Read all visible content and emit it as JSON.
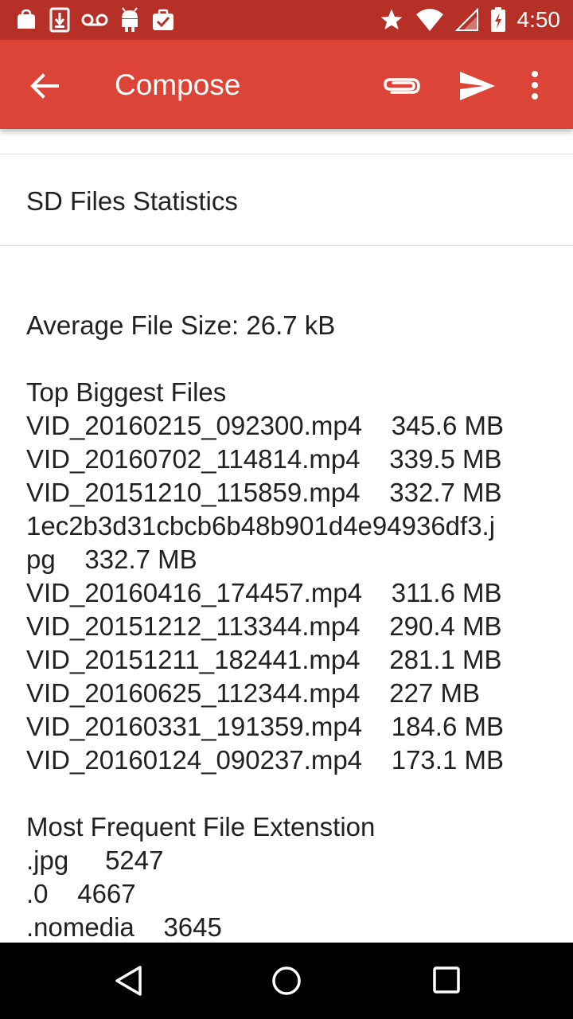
{
  "status_bar": {
    "time": "4:50",
    "left_icons": [
      "bag-icon",
      "download-icon",
      "voicemail-icon",
      "android-icon",
      "clipboard-check-icon"
    ],
    "right_icons": [
      "star-icon",
      "wifi-icon",
      "signal-icon",
      "battery-charging-icon"
    ]
  },
  "app_bar": {
    "title": "Compose",
    "color": "#db4437"
  },
  "subject": "SD Files Statistics",
  "body": {
    "average": "Average File Size: 26.7 kB",
    "biggest_heading": "Top Biggest Files",
    "biggest_files": [
      {
        "name": "VID_20160215_092300.mp4",
        "size": "345.6 MB"
      },
      {
        "name": "VID_20160702_114814.mp4",
        "size": "339.5 MB"
      },
      {
        "name": "VID_20151210_115859.mp4",
        "size": "332.7 MB"
      },
      {
        "name": "1ec2b3d31cbcb6b48b901d4e94936df3.j",
        "size": ""
      },
      {
        "name": "pg",
        "size": "332.7 MB"
      },
      {
        "name": "VID_20160416_174457.mp4",
        "size": "311.6 MB"
      },
      {
        "name": "VID_20151212_113344.mp4",
        "size": "290.4 MB"
      },
      {
        "name": "VID_20151211_182441.mp4",
        "size": "281.1 MB"
      },
      {
        "name": "VID_20160625_112344.mp4",
        "size": "227 MB"
      },
      {
        "name": "VID_20160331_191359.mp4",
        "size": "184.6 MB"
      },
      {
        "name": "VID_20160124_090237.mp4",
        "size": "173.1 MB"
      }
    ],
    "extension_heading": "Most Frequent File Extenstion",
    "extensions": [
      {
        "ext": ".jpg",
        "count": "5247"
      },
      {
        "ext": ".0",
        "count": "4667"
      },
      {
        "ext": ".nomedia",
        "count": "3645"
      }
    ]
  }
}
